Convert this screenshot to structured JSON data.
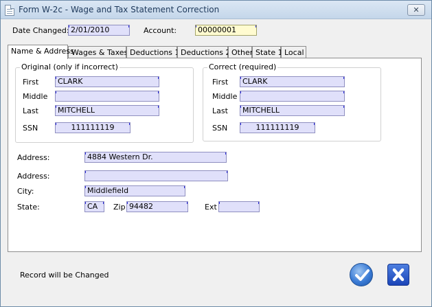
{
  "window": {
    "title": "Form W-2c - Wage and Tax Statement Correction",
    "close_glyph": "✕"
  },
  "header": {
    "date_label": "Date Changed:",
    "date_value": "2/01/2010",
    "account_label": "Account:",
    "account_value": "00000001"
  },
  "tabs": [
    {
      "label": "Name & Address"
    },
    {
      "label": "Wages & Taxes"
    },
    {
      "label": "Deductions 1"
    },
    {
      "label": "Deductions 2"
    },
    {
      "label": "Other"
    },
    {
      "label": "State 1"
    },
    {
      "label": "Local"
    }
  ],
  "original": {
    "title": "Original (only if incorrect)",
    "first_label": "First",
    "first_value": "CLARK",
    "middle_label": "Middle",
    "middle_value": "",
    "last_label": "Last",
    "last_value": "MITCHELL",
    "ssn_label": "SSN",
    "ssn_value": "111111119"
  },
  "correct": {
    "title": "Correct (required)",
    "first_label": "First",
    "first_value": "CLARK",
    "middle_label": "Middle",
    "middle_value": "",
    "last_label": "Last",
    "last_value": "MITCHELL",
    "ssn_label": "SSN",
    "ssn_value": "111111119"
  },
  "address": {
    "address1_label": "Address:",
    "address1_value": "4884 Western Dr.",
    "address2_label": "Address:",
    "address2_value": "",
    "city_label": "City:",
    "city_value": "Middlefield",
    "state_label": "State:",
    "state_value": "CA",
    "zip_label": "Zip",
    "zip_value": "94482",
    "ext_label": "Ext",
    "ext_value": ""
  },
  "footer": {
    "status_text": "Record will be Changed"
  },
  "colors": {
    "field_bg": "#e0e0fa",
    "account_bg": "#fffbd0",
    "accent": "#2a2ad8"
  },
  "icons": {
    "ok": "checkmark-icon",
    "cancel": "x-icon",
    "app": "document-icon"
  }
}
